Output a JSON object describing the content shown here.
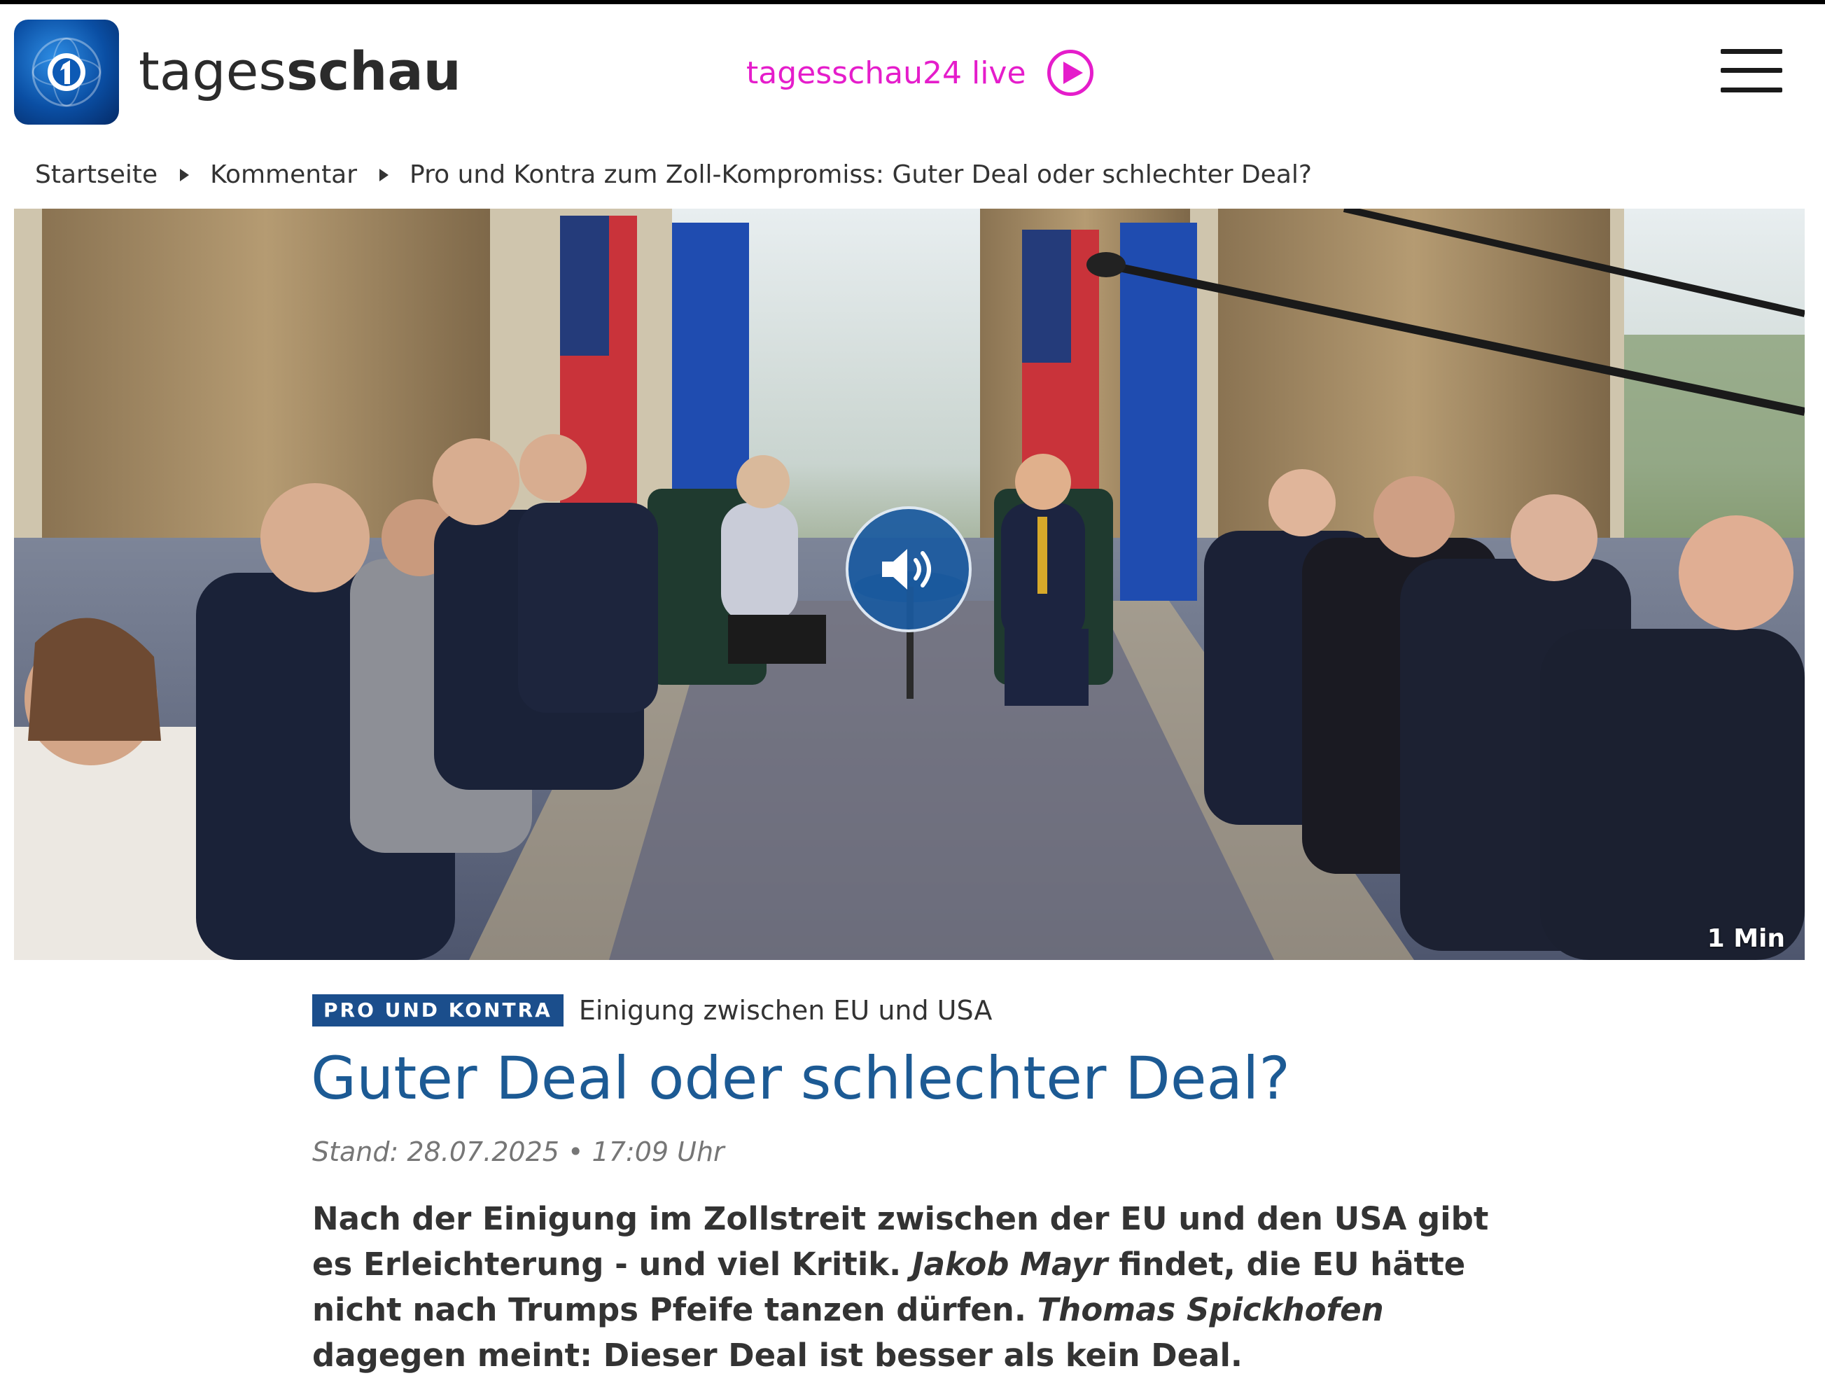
{
  "header": {
    "brand_regular": "tages",
    "brand_bold": "schau",
    "live_label": "tagesschau24 live",
    "live_color": "#e51dcb",
    "logo_icon": "ard-1-globe-icon",
    "menu_icon": "hamburger-menu-icon"
  },
  "breadcrumb": [
    {
      "label": "Startseite"
    },
    {
      "label": "Kommentar"
    },
    {
      "label": "Pro und Kontra zum Zoll-Kompromiss: Guter Deal oder schlechter Deal?"
    }
  ],
  "hero": {
    "audio_icon": "speaker-icon",
    "duration": "1 Min"
  },
  "article": {
    "badge": "PRO UND KONTRA",
    "badge_color": "#1b4e8c",
    "topline": "Einigung zwischen EU und USA",
    "headline": "Guter Deal oder schlechter Deal?",
    "headline_color": "#1c5a94",
    "stand": "Stand: 28.07.2025 • 17:09 Uhr",
    "lead": {
      "part1": "Nach der Einigung im Zollstreit zwischen der EU und den USA gibt es Erleichterung - und viel Kritik. ",
      "author1": "Jakob Mayr",
      "part2": " findet, die EU hätte nicht nach Trumps Pfeife tanzen dürfen. ",
      "author2": "Thomas Spickhofen",
      "part3": " dagegen meint: Dieser Deal ist besser als kein Deal."
    }
  }
}
